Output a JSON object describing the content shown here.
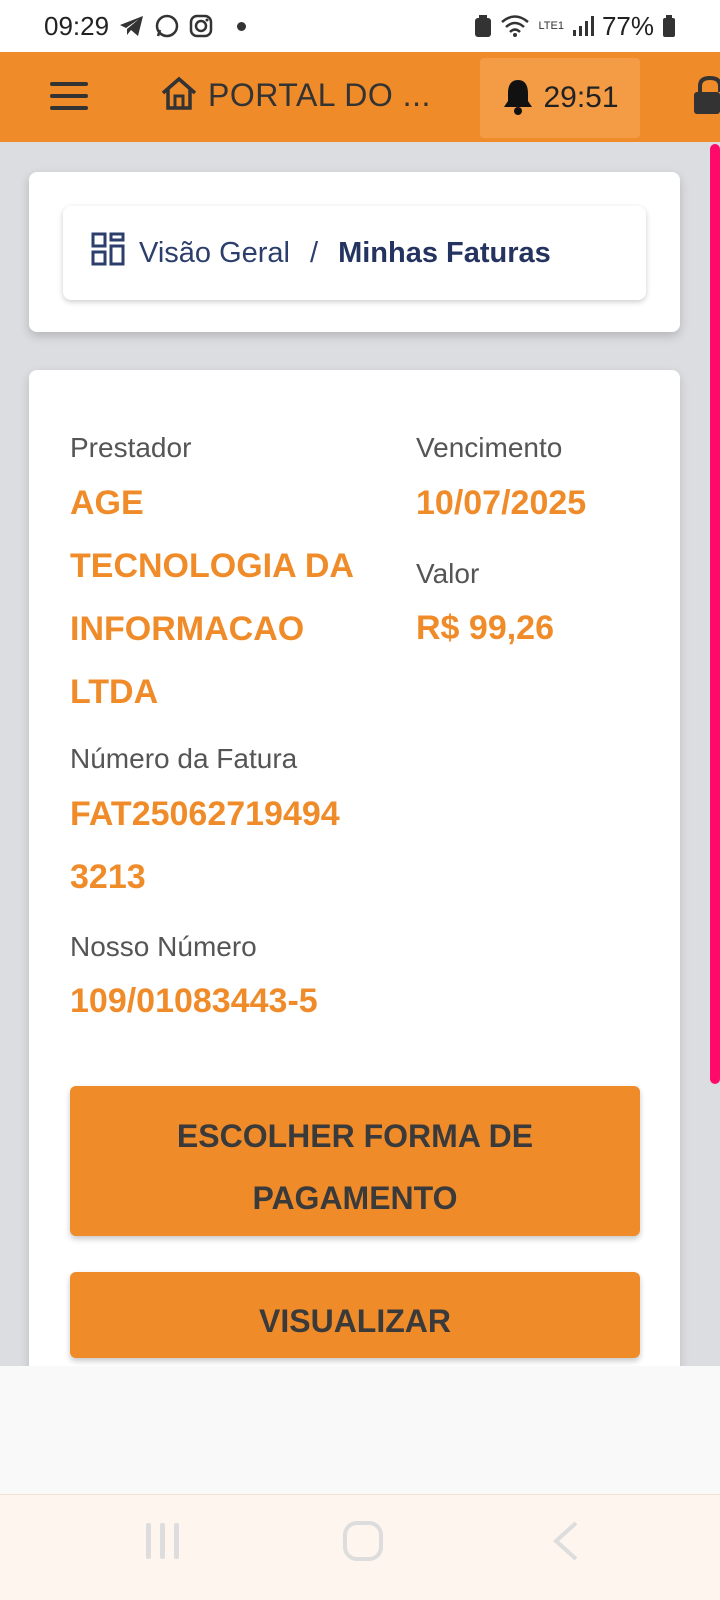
{
  "status_bar": {
    "time": "09:29",
    "battery": "77%",
    "network": "LTE1"
  },
  "app_bar": {
    "title": "PORTAL DO ...",
    "timer": "29:51"
  },
  "breadcrumb": {
    "parent": "Visão Geral",
    "separator": "/",
    "current": "Minhas Faturas"
  },
  "invoice": {
    "provider_label": "Prestador",
    "provider_lines": [
      "AGE",
      "TECNOLOGIA DA",
      "INFORMACAO",
      "LTDA"
    ],
    "due_label": "Vencimento",
    "due_value": "10/07/2025",
    "amount_label": "Valor",
    "amount_value": "R$ 99,26",
    "number_label": "Número da Fatura",
    "number_lines": [
      "FAT25062719494",
      "3213"
    ],
    "our_number_label": "Nosso Número",
    "our_number_value": "109/01083443-5"
  },
  "actions": {
    "payment_lines": [
      "ESCOLHER FORMA DE",
      "PAGAMENTO"
    ],
    "view_label": "VISUALIZAR"
  },
  "colors": {
    "accent": "#f08b2a",
    "text_dark": "#24335f",
    "scroll": "#ff0a6a"
  }
}
